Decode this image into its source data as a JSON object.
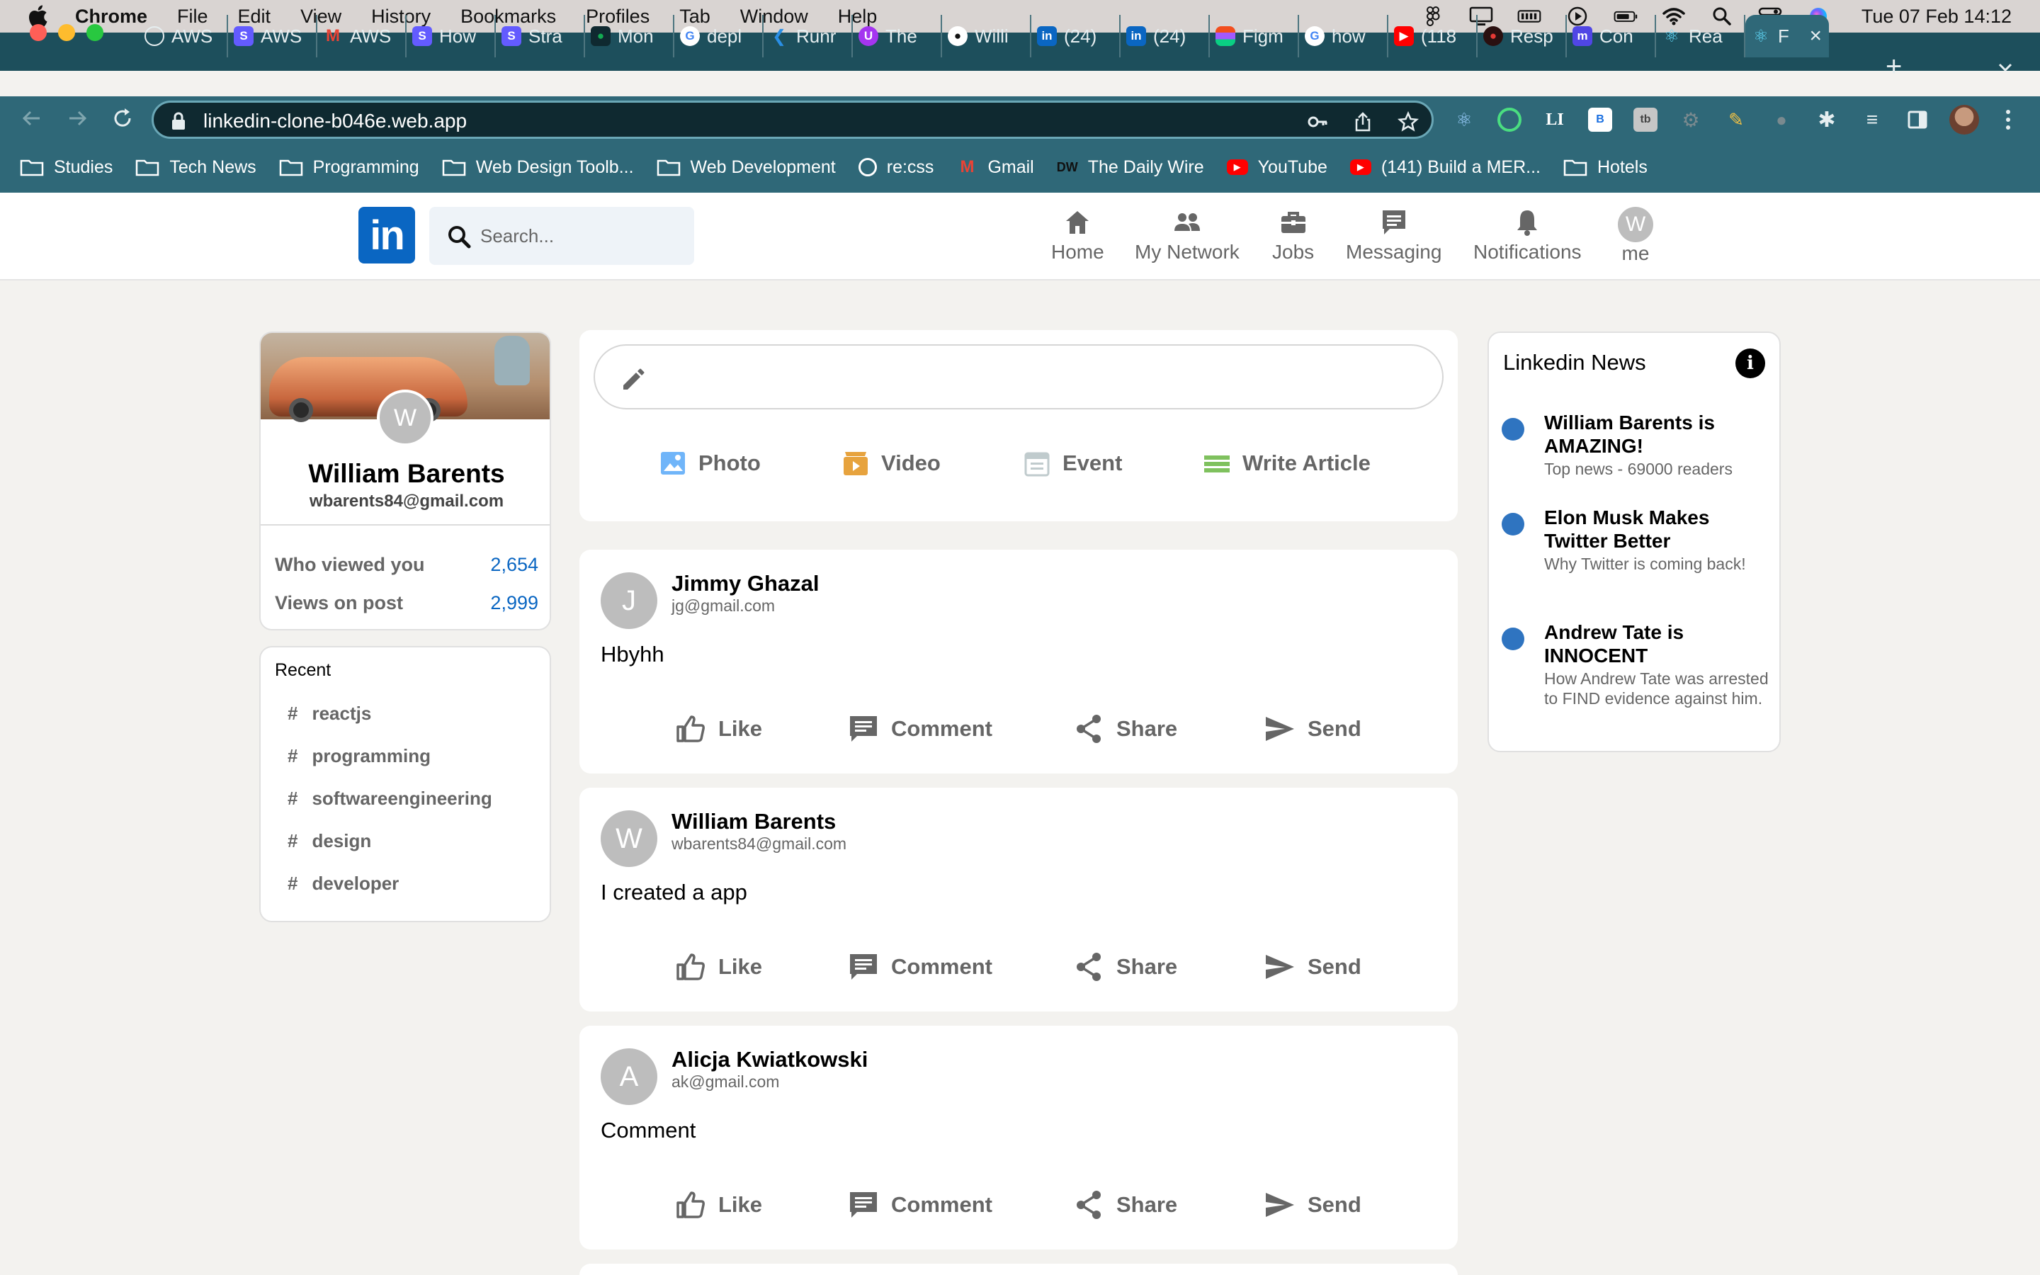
{
  "menubar": {
    "app_name": "Chrome",
    "menus": [
      "File",
      "Edit",
      "View",
      "History",
      "Bookmarks",
      "Profiles",
      "Tab",
      "Window",
      "Help"
    ],
    "clock": "Tue 07 Feb  14:12"
  },
  "browser": {
    "tabs": [
      {
        "label": "AWS",
        "icon": "globe-icon",
        "color": "#ffffff"
      },
      {
        "label": "AWS",
        "icon": "stripe-icon",
        "color": "#635bff"
      },
      {
        "label": "AWS",
        "icon": "gmail-icon",
        "color": "#ea4335"
      },
      {
        "label": "How",
        "icon": "stripe-icon",
        "color": "#635bff"
      },
      {
        "label": "Stra",
        "icon": "stripe-icon",
        "color": "#635bff"
      },
      {
        "label": "Mon",
        "icon": "mongodb-icon",
        "color": "#13aa52"
      },
      {
        "label": "depl",
        "icon": "google-icon",
        "color": "#ffffff"
      },
      {
        "label": "Runr",
        "icon": "vscode-icon",
        "color": "#2a8fe6"
      },
      {
        "label": "The",
        "icon": "udemy-icon",
        "color": "#a435f0"
      },
      {
        "label": "Willi",
        "icon": "github-icon",
        "color": "#ffffff"
      },
      {
        "label": "(24)",
        "icon": "linkedin-icon",
        "color": "#0a66c2"
      },
      {
        "label": "(24)",
        "icon": "linkedin-icon",
        "color": "#0a66c2"
      },
      {
        "label": "Figm",
        "icon": "figma-icon",
        "color": "#f24e1e"
      },
      {
        "label": "how",
        "icon": "google-icon",
        "color": "#ffffff"
      },
      {
        "label": "(118",
        "icon": "youtube-icon",
        "color": "#ff0000"
      },
      {
        "label": "Resp",
        "icon": "incognito-icon",
        "color": "#c62828"
      },
      {
        "label": "Con",
        "icon": "medium-icon",
        "color": "#5046e5"
      },
      {
        "label": "Rea",
        "icon": "react-icon",
        "color": "#61dafb"
      },
      {
        "label": "F",
        "icon": "react-icon",
        "color": "#61dafb",
        "active": true
      }
    ],
    "url": "linkedin-clone-b046e.web.app",
    "bookmarks": [
      {
        "label": "Studies",
        "icon": "folder-icon"
      },
      {
        "label": "Tech News",
        "icon": "folder-icon"
      },
      {
        "label": "Programming",
        "icon": "folder-icon"
      },
      {
        "label": "Web Design Toolb...",
        "icon": "folder-icon"
      },
      {
        "label": "Web Development",
        "icon": "folder-icon"
      },
      {
        "label": "re:css",
        "icon": "globe-icon"
      },
      {
        "label": "Gmail",
        "icon": "gmail-icon"
      },
      {
        "label": "The Daily Wire",
        "icon": "dailywire-icon"
      },
      {
        "label": "YouTube",
        "icon": "youtube-icon"
      },
      {
        "label": "(141) Build a MER...",
        "icon": "youtube-icon"
      },
      {
        "label": "Hotels",
        "icon": "folder-icon"
      }
    ]
  },
  "header": {
    "logo_text": "in",
    "search_placeholder": "Search...",
    "nav": {
      "home": "Home",
      "network": "My Network",
      "jobs": "Jobs",
      "messaging": "Messaging",
      "notifications": "Notifications",
      "me": "me",
      "me_initial": "W"
    }
  },
  "sidebar": {
    "avatar_initial": "W",
    "name": "William Barents",
    "email": "wbarents84@gmail.com",
    "stats": [
      {
        "label": "Who viewed you",
        "value": "2,654"
      },
      {
        "label": "Views on post",
        "value": "2,999"
      }
    ],
    "recent_title": "Recent",
    "recent_items": [
      "reactjs",
      "programming",
      "softwareengineering",
      "design",
      "developer"
    ]
  },
  "composer": {
    "options": {
      "photo": "Photo",
      "video": "Video",
      "event": "Event",
      "article": "Write Article"
    },
    "colors": {
      "photo": "#70b5f9",
      "video": "#e7a33e",
      "event": "#c0cbcd",
      "article": "#7fc15e"
    }
  },
  "post_actions": {
    "like": "Like",
    "comment": "Comment",
    "share": "Share",
    "send": "Send"
  },
  "posts": [
    {
      "initial": "J",
      "author": "Jimmy Ghazal",
      "email": "jg@gmail.com",
      "message": "Hbyhh"
    },
    {
      "initial": "W",
      "author": "William Barents",
      "email": "wbarents84@gmail.com",
      "message": "I created a app"
    },
    {
      "initial": "A",
      "author": "Alicja Kwiatkowski",
      "email": "ak@gmail.com",
      "message": "Comment"
    }
  ],
  "news": {
    "title": "Linkedin News",
    "articles": [
      {
        "heading": "William Barents is AMAZING!",
        "subtitle": "Top news - 69000 readers"
      },
      {
        "heading": "Elon Musk Makes Twitter Better",
        "subtitle": "Why Twitter is coming back!"
      },
      {
        "heading": "Andrew Tate is INNOCENT",
        "subtitle": "How Andrew Tate was arrested to FIND evidence against him."
      }
    ]
  },
  "colors": {
    "linkedin_blue": "#0a66c2",
    "page_bg": "#f3f2ef",
    "chrome_tabstrip": "#1d4f5c",
    "chrome_toolbar": "#2f6878"
  }
}
